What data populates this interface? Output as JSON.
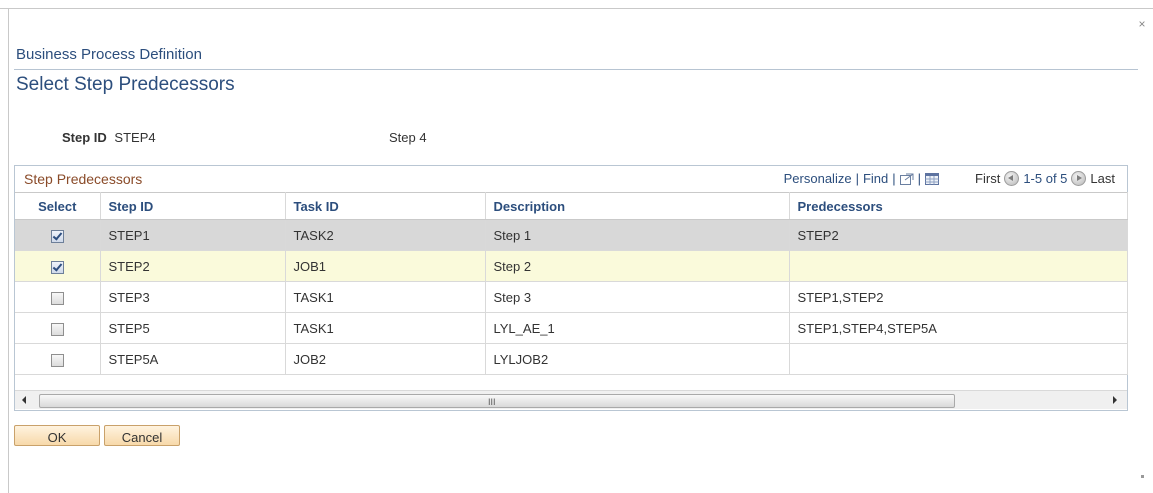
{
  "header": {
    "close_glyph": "×",
    "breadcrumb": "Business Process Definition",
    "page_title": "Select Step Predecessors"
  },
  "step_field": {
    "label": "Step ID",
    "value": "STEP4",
    "description": "Step 4"
  },
  "grid": {
    "title": "Step Predecessors",
    "nav": {
      "personalize": "Personalize",
      "find": "Find",
      "separator": "|",
      "first": "First",
      "range": "1-5 of 5",
      "last": "Last"
    },
    "columns": [
      "Select",
      "Step ID",
      "Task ID",
      "Description",
      "Predecessors"
    ],
    "rows": [
      {
        "selected": true,
        "step_id": "STEP1",
        "task_id": "TASK2",
        "description": "Step 1",
        "predecessors": "STEP2"
      },
      {
        "selected": true,
        "step_id": "STEP2",
        "task_id": "JOB1",
        "description": "Step 2",
        "predecessors": ""
      },
      {
        "selected": false,
        "step_id": "STEP3",
        "task_id": "TASK1",
        "description": "Step 3",
        "predecessors": "STEP1,STEP2"
      },
      {
        "selected": false,
        "step_id": "STEP5",
        "task_id": "TASK1",
        "description": "LYL_AE_1",
        "predecessors": "STEP1,STEP4,STEP5A"
      },
      {
        "selected": false,
        "step_id": "STEP5A",
        "task_id": "JOB2",
        "description": "LYLJOB2",
        "predecessors": ""
      }
    ],
    "scroll_grip": "III"
  },
  "buttons": {
    "ok": "OK",
    "cancel": "Cancel"
  }
}
